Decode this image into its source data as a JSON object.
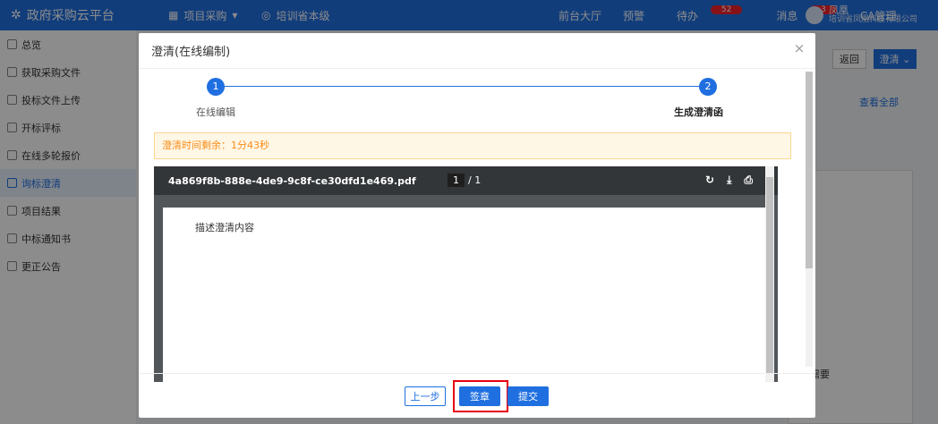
{
  "topbar": {
    "logo_text": "政府采购云平台",
    "menu_label": "项目采购",
    "location_label": "培训省本级",
    "nav": {
      "front_hall": "前台大厅",
      "warning": "预警",
      "todo": "待办",
      "todo_count": "52",
      "message": "消息",
      "message_count": "3",
      "ca": "CA管理"
    },
    "user_name": "凤凰",
    "user_org": "培训省凤凰科技有限公司"
  },
  "sidebar": {
    "items": [
      {
        "label": "总览"
      },
      {
        "label": "获取采购文件"
      },
      {
        "label": "投标文件上传"
      },
      {
        "label": "开标评标"
      },
      {
        "label": "在线多轮报价"
      },
      {
        "label": "询标澄清"
      },
      {
        "label": "项目结果"
      },
      {
        "label": "中标通知书"
      },
      {
        "label": "更正公告"
      }
    ]
  },
  "background": {
    "back_label": "返回",
    "clarify_label": "澄清",
    "view_all": "查看全部",
    "partial_text": "需要"
  },
  "modal": {
    "title": "澄清(在线编制)",
    "close": "×",
    "steps": [
      {
        "number": "1",
        "label": "在线编辑"
      },
      {
        "number": "2",
        "label": "生成澄清函"
      }
    ],
    "timer_text": "澄清时间剩余：1分43秒",
    "pdf": {
      "filename": "4a869f8b-888e-4de9-9c8f-ce30dfd1e469.pdf",
      "page_current": "1",
      "page_total": "/ 1",
      "content": "描述澄清内容"
    },
    "buttons": {
      "prev": "上一步",
      "sign": "签章",
      "submit": "提交"
    }
  },
  "colors": {
    "primary": "#1f6fe0",
    "highlight": "#e60012",
    "timer_bg": "#fff7e6",
    "timer_text": "#fa8c16"
  }
}
